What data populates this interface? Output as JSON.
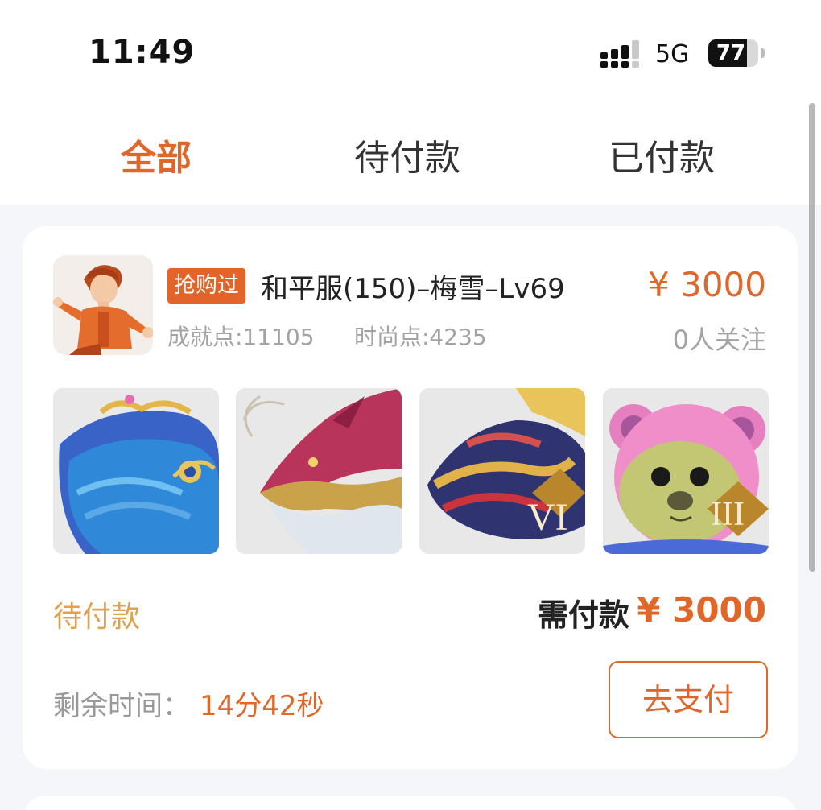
{
  "status_bar": {
    "time": "11:49",
    "network": "5G",
    "battery_level": 77,
    "battery_text": "77"
  },
  "tabs": [
    {
      "label": "全部",
      "active": true
    },
    {
      "label": "待付款",
      "active": false
    },
    {
      "label": "已付款",
      "active": false
    }
  ],
  "order": {
    "badge": "抢购过",
    "title": "和平服(150)–梅雪–Lv69",
    "price": "¥ 3000",
    "achievement": "成就点:11105",
    "fashion": "时尚点:4235",
    "followers": "0人关注",
    "thumbnails": [
      {
        "icon": "whale-mount-icon"
      },
      {
        "icon": "dragon-mount-icon",
        "rank": ""
      },
      {
        "icon": "golden-dragon-mount-icon",
        "rank": "VI"
      },
      {
        "icon": "pink-bear-costume-icon",
        "rank": "III"
      }
    ],
    "status": "待付款",
    "due_label": "需付款",
    "due_amount": "¥ 3000",
    "remaining_label": "剩余时间：",
    "remaining_value": "14分42秒",
    "pay_button": "去支付"
  },
  "colors": {
    "accent": "#e0672a",
    "status": "#e0a14a",
    "muted": "#a3a3a3",
    "background": "#f4f6f9"
  }
}
